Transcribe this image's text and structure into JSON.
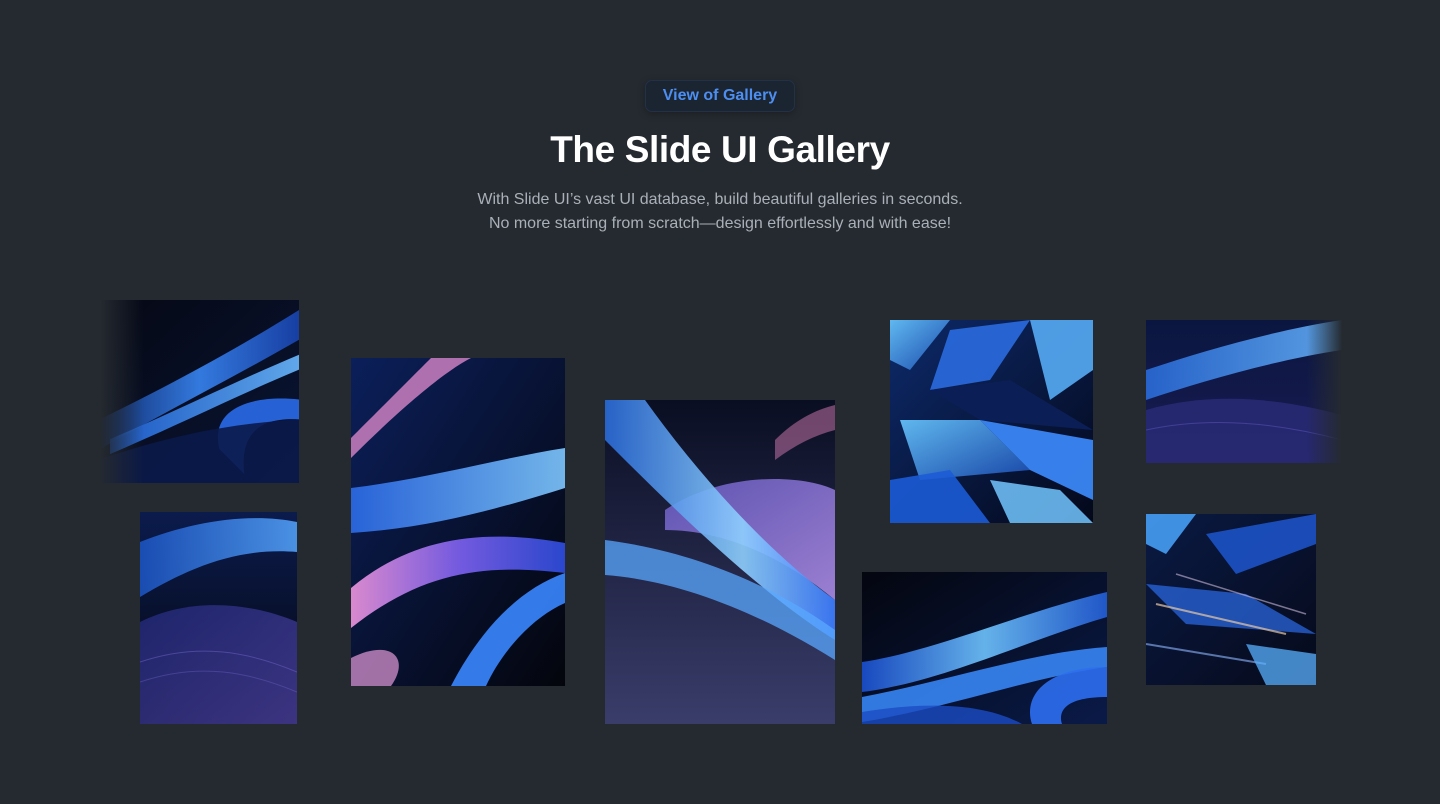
{
  "badge": {
    "label": "View of Gallery"
  },
  "heading": {
    "title": "The Slide UI Gallery",
    "subtitle_line1": "With Slide UI’s vast UI database, build beautiful galleries in seconds.",
    "subtitle_line2": "No more starting from scratch—design effortlessly and with ease!"
  },
  "gallery": {
    "images": [
      {
        "name": "abstract-blue-waves-1"
      },
      {
        "name": "abstract-blue-dunes-1"
      },
      {
        "name": "abstract-ribbons-pink-blue"
      },
      {
        "name": "abstract-ribbons-lavender"
      },
      {
        "name": "abstract-crystal-shards"
      },
      {
        "name": "abstract-blue-waves-2"
      },
      {
        "name": "abstract-blue-dunes-2"
      },
      {
        "name": "abstract-light-streaks"
      }
    ]
  },
  "colors": {
    "background": "#252a30",
    "accent": "#4d8ff0",
    "title": "#ffffff",
    "subtitle": "#aab0b8"
  }
}
